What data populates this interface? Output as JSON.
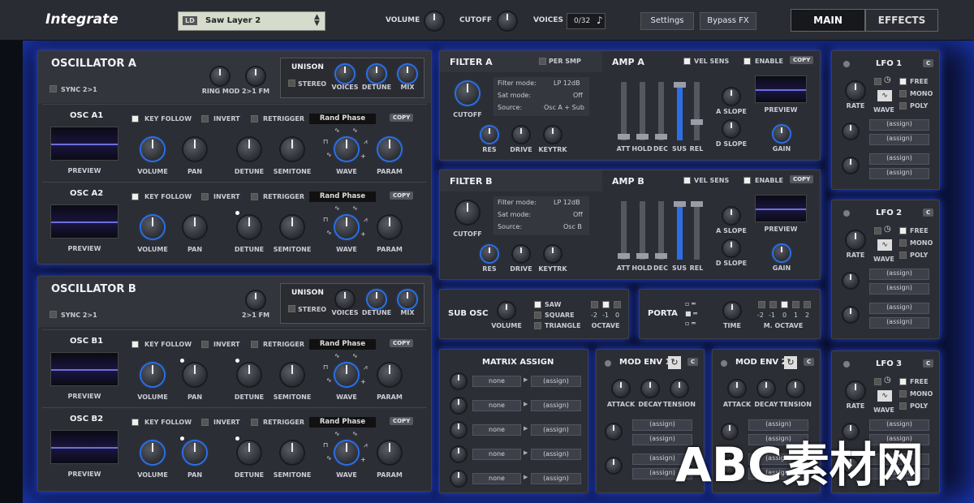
{
  "app": {
    "title": "Integrate"
  },
  "preset": {
    "badge": "LD",
    "name": "Saw Layer 2"
  },
  "header": {
    "volume": "VOLUME",
    "cutoff": "CUTOFF",
    "voices": "VOICES",
    "voices_value": "0/32",
    "settings": "Settings",
    "bypass": "Bypass FX",
    "tab_main": "MAIN",
    "tab_effects": "EFFECTS"
  },
  "oscA": {
    "title": "OSCILLATOR A",
    "sync": "SYNC 2>1",
    "ringmod": "RING MOD",
    "fm": "2>1 FM",
    "unison": "UNISON",
    "stereo": "STEREO",
    "voices": "VOICES",
    "detune": "DETUNE",
    "mix": "MIX"
  },
  "oscB": {
    "title": "OSCILLATOR B",
    "sync": "SYNC 2>1",
    "fm": "2>1 FM",
    "unison": "UNISON",
    "stereo": "STEREO",
    "voices": "VOICES",
    "detune": "DETUNE",
    "mix": "MIX"
  },
  "rows": [
    {
      "name": "OSC A1"
    },
    {
      "name": "OSC A2"
    },
    {
      "name": "OSC B1"
    },
    {
      "name": "OSC B2"
    }
  ],
  "row_labels": {
    "key_follow": "KEY FOLLOW",
    "invert": "INVERT",
    "retrigger": "RETRIGGER",
    "phase": "Rand Phase",
    "copy": "COPY",
    "preview": "PREVIEW",
    "volume": "VOLUME",
    "pan": "PAN",
    "detune": "DETUNE",
    "semitone": "SEMITONE",
    "wave": "WAVE",
    "param": "PARAM"
  },
  "filterA": {
    "title": "FILTER A",
    "per_smp": "PER SMP",
    "mode_label": "Filter mode:",
    "mode": "LP 12dB",
    "sat_label": "Sat mode:",
    "sat": "Off",
    "source_label": "Source:",
    "source": "Osc A + Sub",
    "cutoff": "CUTOFF",
    "res": "RES",
    "drive": "DRIVE",
    "keytrk": "KEYTRK"
  },
  "filterB": {
    "title": "FILTER B",
    "mode_label": "Filter mode:",
    "mode": "LP 12dB",
    "sat_label": "Sat mode:",
    "sat": "Off",
    "source_label": "Source:",
    "source": "Osc B",
    "cutoff": "CUTOFF",
    "res": "RES",
    "drive": "DRIVE",
    "keytrk": "KEYTRK"
  },
  "ampA": {
    "title": "AMP A",
    "vel_sens": "VEL SENS",
    "enable": "ENABLE",
    "copy": "COPY",
    "att": "ATT",
    "hold": "HOLD",
    "dec": "DEC",
    "sus": "SUS",
    "rel": "REL",
    "a_slope": "A SLOPE",
    "d_slope": "D SLOPE",
    "preview": "PREVIEW",
    "gain": "GAIN"
  },
  "ampB": {
    "title": "AMP B",
    "vel_sens": "VEL SENS",
    "enable": "ENABLE",
    "copy": "COPY",
    "att": "ATT",
    "hold": "HOLD",
    "dec": "DEC",
    "sus": "SUS",
    "rel": "REL",
    "a_slope": "A SLOPE",
    "d_slope": "D SLOPE",
    "preview": "PREVIEW",
    "gain": "GAIN"
  },
  "sub": {
    "title": "SUB OSC",
    "volume": "VOLUME",
    "saw": "SAW",
    "square": "SQUARE",
    "triangle": "TRIANGLE",
    "oct_vals": [
      "-2",
      "-1",
      "0"
    ],
    "octave": "OCTAVE"
  },
  "porta": {
    "title": "PORTA",
    "time": "TIME",
    "oct_vals": [
      "-2",
      "-1",
      "0",
      "1",
      "2"
    ],
    "moctave": "M. OCTAVE"
  },
  "matrix": {
    "title": "MATRIX ASSIGN",
    "rows": [
      {
        "src": "none",
        "dst": "(assign)"
      },
      {
        "src": "none",
        "dst": "(assign)"
      },
      {
        "src": "none",
        "dst": "(assign)"
      },
      {
        "src": "none",
        "dst": "(assign)"
      },
      {
        "src": "none",
        "dst": "(assign)"
      }
    ]
  },
  "env1": {
    "title": "MOD ENV 1",
    "c": "C",
    "attack": "ATTACK",
    "decay": "DECAY",
    "tension": "TENSION",
    "assign": "(assign)"
  },
  "env2": {
    "title": "MOD ENV 2",
    "c": "C",
    "attack": "ATTACK",
    "decay": "DECAY",
    "tension": "TENSION",
    "assign": "(assign)"
  },
  "lfo1": {
    "title": "LFO 1",
    "c": "C",
    "free": "FREE",
    "mono": "MONO",
    "poly": "POLY",
    "rate": "RATE",
    "wave": "WAVE",
    "assign": "(assign)"
  },
  "lfo2": {
    "title": "LFO 2",
    "c": "C",
    "free": "FREE",
    "mono": "MONO",
    "poly": "POLY",
    "rate": "RATE",
    "wave": "WAVE",
    "assign": "(assign)"
  },
  "lfo3": {
    "title": "LFO 3",
    "c": "C",
    "free": "FREE",
    "mono": "MONO",
    "poly": "POLY",
    "rate": "RATE",
    "wave": "WAVE",
    "assign": "(assign)"
  },
  "watermark": "ABC素材网",
  "colors": {
    "accent": "#2a6fe6",
    "glow": "#2748e0",
    "panel": "#2c2e35"
  }
}
